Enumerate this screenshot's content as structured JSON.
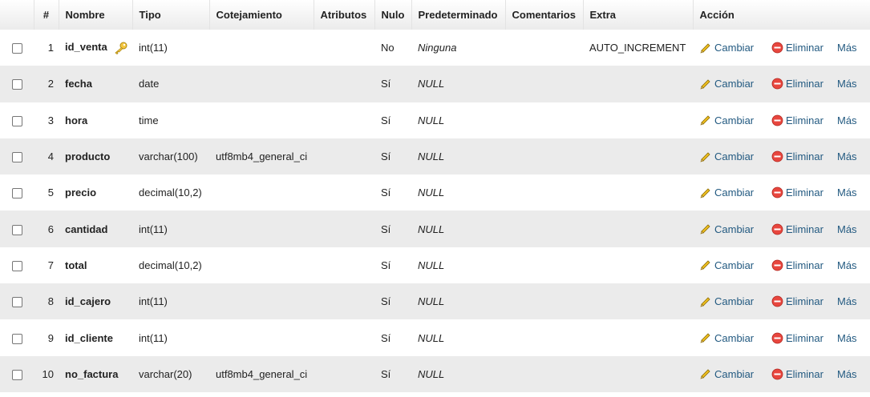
{
  "headers": {
    "num": "#",
    "nombre": "Nombre",
    "tipo": "Tipo",
    "cotejamiento": "Cotejamiento",
    "atributos": "Atributos",
    "nulo": "Nulo",
    "predeterminado": "Predeterminado",
    "comentarios": "Comentarios",
    "extra": "Extra",
    "accion": "Acción"
  },
  "actions": {
    "change": "Cambiar",
    "drop": "Eliminar",
    "more": "Más"
  },
  "colors": {
    "link": "#235a81",
    "row_alt": "#ebebeb",
    "drop_icon": "#e8463e",
    "change_icon": "#f0c020"
  },
  "icons": {
    "primary_key": "key-icon",
    "change": "pencil-icon",
    "drop": "drop-icon"
  },
  "rows": [
    {
      "num": "1",
      "name": "id_venta",
      "primary_key": true,
      "type": "int(11)",
      "collation": "",
      "attributes": "",
      "null": "No",
      "default": "Ninguna",
      "comments": "",
      "extra": "AUTO_INCREMENT"
    },
    {
      "num": "2",
      "name": "fecha",
      "type": "date",
      "collation": "",
      "attributes": "",
      "null": "Sí",
      "default": "NULL",
      "comments": "",
      "extra": ""
    },
    {
      "num": "3",
      "name": "hora",
      "type": "time",
      "collation": "",
      "attributes": "",
      "null": "Sí",
      "default": "NULL",
      "comments": "",
      "extra": ""
    },
    {
      "num": "4",
      "name": "producto",
      "type": "varchar(100)",
      "collation": "utf8mb4_general_ci",
      "attributes": "",
      "null": "Sí",
      "default": "NULL",
      "comments": "",
      "extra": ""
    },
    {
      "num": "5",
      "name": "precio",
      "type": "decimal(10,2)",
      "collation": "",
      "attributes": "",
      "null": "Sí",
      "default": "NULL",
      "comments": "",
      "extra": ""
    },
    {
      "num": "6",
      "name": "cantidad",
      "type": "int(11)",
      "collation": "",
      "attributes": "",
      "null": "Sí",
      "default": "NULL",
      "comments": "",
      "extra": ""
    },
    {
      "num": "7",
      "name": "total",
      "type": "decimal(10,2)",
      "collation": "",
      "attributes": "",
      "null": "Sí",
      "default": "NULL",
      "comments": "",
      "extra": ""
    },
    {
      "num": "8",
      "name": "id_cajero",
      "type": "int(11)",
      "collation": "",
      "attributes": "",
      "null": "Sí",
      "default": "NULL",
      "comments": "",
      "extra": ""
    },
    {
      "num": "9",
      "name": "id_cliente",
      "type": "int(11)",
      "collation": "",
      "attributes": "",
      "null": "Sí",
      "default": "NULL",
      "comments": "",
      "extra": ""
    },
    {
      "num": "10",
      "name": "no_factura",
      "type": "varchar(20)",
      "collation": "utf8mb4_general_ci",
      "attributes": "",
      "null": "Sí",
      "default": "NULL",
      "comments": "",
      "extra": ""
    }
  ]
}
